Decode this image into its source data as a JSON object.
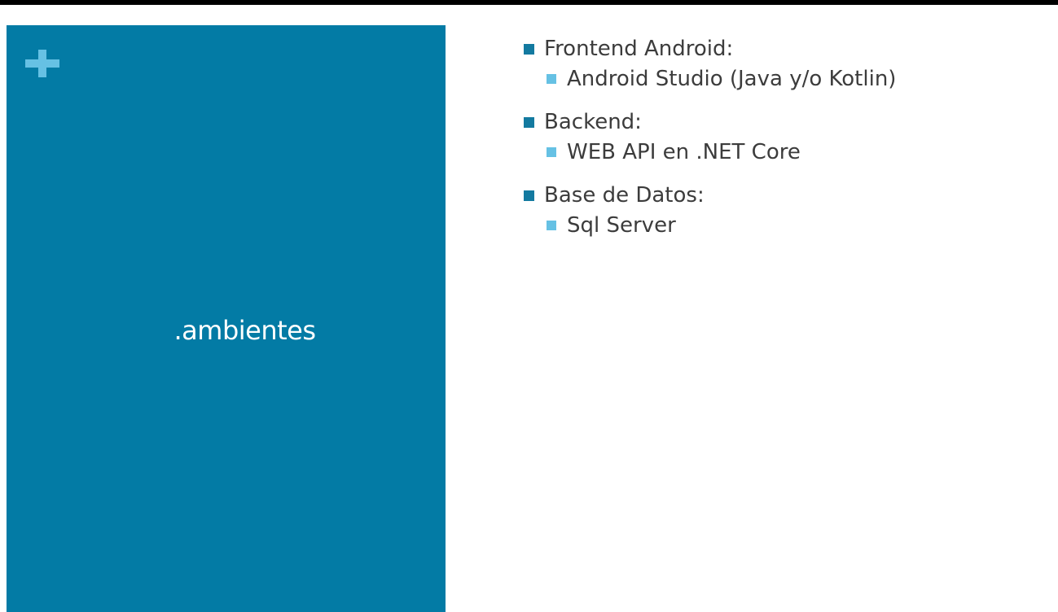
{
  "slide": {
    "title": ".ambientes",
    "colors": {
      "panel": "#037ba5",
      "accent": "#66c1e4",
      "bullet_primary": "#137aa0",
      "text": "#3c3c3c"
    },
    "icons": [
      "plus-icon"
    ],
    "items": [
      {
        "label": "Frontend Android:",
        "subitems": [
          {
            "label": "Android Studio (Java y/o Kotlin)"
          }
        ]
      },
      {
        "label": "Backend:",
        "subitems": [
          {
            "label": "WEB API en .NET Core"
          }
        ]
      },
      {
        "label": "Base de Datos:",
        "subitems": [
          {
            "label": "Sql Server"
          }
        ]
      }
    ]
  }
}
